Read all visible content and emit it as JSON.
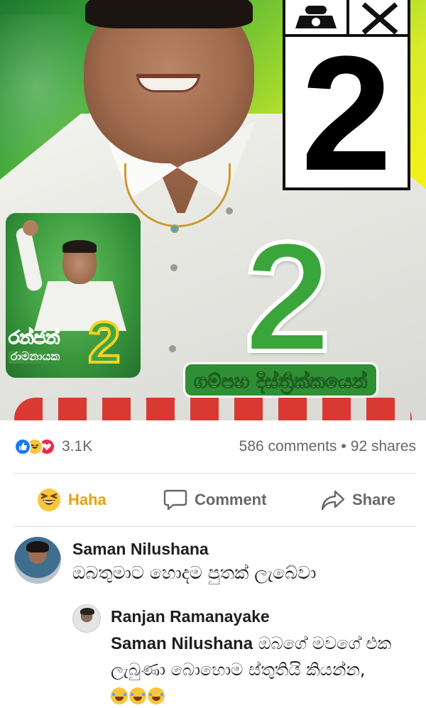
{
  "post": {
    "image": {
      "ballot_number": "2",
      "big_number": "2",
      "inset_name_line1": "රන්ජන්",
      "inset_name_line2": "රාමනායක",
      "inset_number": "2",
      "district_banner": "ගම්පහ දිස්ත්‍රික්කයෙන්"
    },
    "reactions": {
      "types": [
        "like-icon",
        "haha-icon",
        "love-icon"
      ],
      "count": "3.1K"
    },
    "comments_count": "586 comments",
    "separator": "•",
    "shares_count": "92 shares"
  },
  "actions": {
    "haha_label": "Haha",
    "comment_label": "Comment",
    "share_label": "Share"
  },
  "comments": [
    {
      "author": "Saman Nilushana",
      "text": "ඔබතුමාට හොදම පුතක් ලැබේවා"
    },
    {
      "author": "Ranjan Ramanayake",
      "mention": "Saman Nilushana",
      "text": " ඔබගේ මවගේ එක ලැබුණා බොහොම ස්තුතියි කියන්න,"
    }
  ],
  "colors": {
    "facebook_blue": "#1877f2",
    "haha_yellow": "#f7c63c",
    "love_red": "#f0284a",
    "muted_text": "#65676b",
    "haha_label": "#e8a20c"
  }
}
